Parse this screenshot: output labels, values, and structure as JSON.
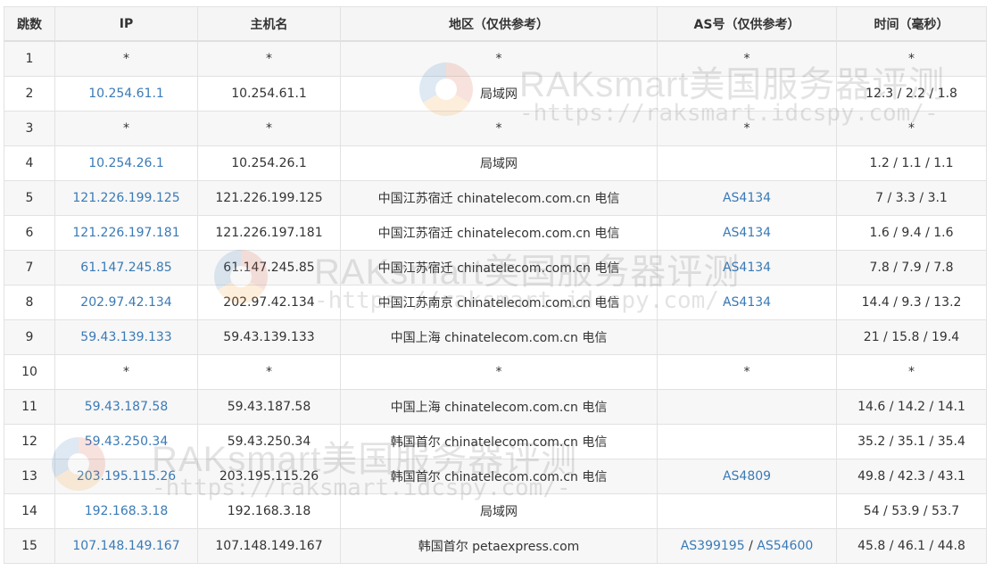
{
  "headers": {
    "hop": "跳数",
    "ip": "IP",
    "host": "主机名",
    "region": "地区（仅供参考）",
    "as": "AS号（仅供参考）",
    "time": "时间（毫秒）"
  },
  "rows": [
    {
      "hop": "1",
      "ip": "*",
      "host": "*",
      "region": "*",
      "as": [
        "*"
      ],
      "time": "*"
    },
    {
      "hop": "2",
      "ip": "10.254.61.1",
      "host": "10.254.61.1",
      "region": "局域网",
      "as": [],
      "time": "12.3 / 2.2 / 1.8"
    },
    {
      "hop": "3",
      "ip": "*",
      "host": "*",
      "region": "*",
      "as": [
        "*"
      ],
      "time": "*"
    },
    {
      "hop": "4",
      "ip": "10.254.26.1",
      "host": "10.254.26.1",
      "region": "局域网",
      "as": [],
      "time": "1.2 / 1.1 / 1.1"
    },
    {
      "hop": "5",
      "ip": "121.226.199.125",
      "host": "121.226.199.125",
      "region": "中国江苏宿迁 chinatelecom.com.cn 电信",
      "as": [
        "AS4134"
      ],
      "time": "7 / 3.3 / 3.1"
    },
    {
      "hop": "6",
      "ip": "121.226.197.181",
      "host": "121.226.197.181",
      "region": "中国江苏宿迁 chinatelecom.com.cn 电信",
      "as": [
        "AS4134"
      ],
      "time": "1.6 / 9.4 / 1.6"
    },
    {
      "hop": "7",
      "ip": "61.147.245.85",
      "host": "61.147.245.85",
      "region": "中国江苏宿迁 chinatelecom.com.cn 电信",
      "as": [
        "AS4134"
      ],
      "time": "7.8 / 7.9 / 7.8"
    },
    {
      "hop": "8",
      "ip": "202.97.42.134",
      "host": "202.97.42.134",
      "region": "中国江苏南京 chinatelecom.com.cn 电信",
      "as": [
        "AS4134"
      ],
      "time": "14.4 / 9.3 / 13.2"
    },
    {
      "hop": "9",
      "ip": "59.43.139.133",
      "host": "59.43.139.133",
      "region": "中国上海 chinatelecom.com.cn 电信",
      "as": [],
      "time": "21 / 15.8 / 19.4"
    },
    {
      "hop": "10",
      "ip": "*",
      "host": "*",
      "region": "*",
      "as": [
        "*"
      ],
      "time": "*"
    },
    {
      "hop": "11",
      "ip": "59.43.187.58",
      "host": "59.43.187.58",
      "region": "中国上海 chinatelecom.com.cn 电信",
      "as": [],
      "time": "14.6 / 14.2 / 14.1"
    },
    {
      "hop": "12",
      "ip": "59.43.250.34",
      "host": "59.43.250.34",
      "region": "韩国首尔 chinatelecom.com.cn 电信",
      "as": [],
      "time": "35.2 / 35.1 / 35.4"
    },
    {
      "hop": "13",
      "ip": "203.195.115.26",
      "host": "203.195.115.26",
      "region": "韩国首尔 chinatelecom.com.cn 电信",
      "as": [
        "AS4809"
      ],
      "time": "49.8 / 42.3 / 43.1"
    },
    {
      "hop": "14",
      "ip": "192.168.3.18",
      "host": "192.168.3.18",
      "region": "局域网",
      "as": [],
      "time": "54 / 53.9 / 53.7"
    },
    {
      "hop": "15",
      "ip": "107.148.149.167",
      "host": "107.148.149.167",
      "region": "韩国首尔 petaexpress.com",
      "as": [
        "AS399195",
        "AS54600"
      ],
      "time": "45.8 / 46.1 / 44.8"
    }
  ],
  "as_separator": " / ",
  "watermark": {
    "title": "RAKsmart美国服务器评测",
    "url": "-https://raksmart.idcspy.com/-"
  },
  "colors": {
    "link": "#3a7ab6",
    "header_bg": "#f5f5f5",
    "stripe_bg": "#f7f7f7",
    "border": "#e2e2e2"
  }
}
